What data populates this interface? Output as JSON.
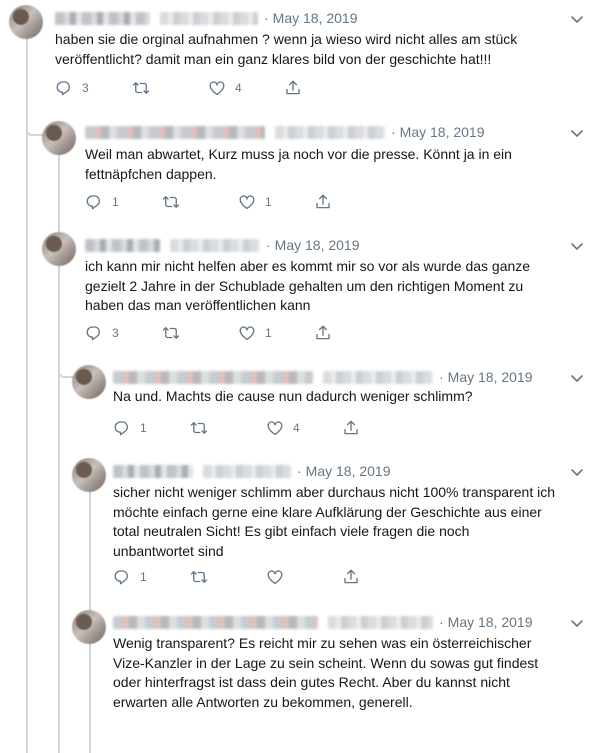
{
  "tweets": [
    {
      "date": "May 18, 2019",
      "text_lines": [
        "haben sie die orginal aufnahmen ? wenn ja wieso wird nicht alles am stück",
        "veröffentlicht? damit man ein ganz klares bild von der geschichte hat!!!"
      ],
      "replies": "3",
      "retweets": "",
      "likes": "4"
    },
    {
      "date": "May 18, 2019",
      "text_lines": [
        "Weil man abwartet, Kurz muss ja noch vor die presse. Könnt ja in ein",
        "fettnäpfchen dappen."
      ],
      "replies": "1",
      "retweets": "",
      "likes": "1"
    },
    {
      "date": "May 18, 2019",
      "text_lines": [
        "ich kann mir nicht helfen aber es kommt mir so vor als wurde das ganze",
        "gezielt 2 Jahre in der Schublade gehalten um den richtigen Moment zu",
        "haben das man veröffentlichen kann"
      ],
      "replies": "3",
      "retweets": "",
      "likes": "1"
    },
    {
      "date": "May 18, 2019",
      "text_lines": [
        "Na und. Machts die cause nun dadurch weniger schlimm?"
      ],
      "replies": "1",
      "retweets": "",
      "likes": "4"
    },
    {
      "date": "May 18, 2019",
      "text_lines": [
        "sicher nicht weniger schlimm aber durchaus nicht 100% transparent ich",
        "möchte einfach gerne eine klare Aufklärung der Geschichte aus einer",
        "total neutralen Sicht! Es gibt einfach viele fragen die noch",
        "unbantwortet sind"
      ],
      "replies": "1",
      "retweets": "",
      "likes": ""
    },
    {
      "date": "May 18, 2019",
      "text_lines": [
        "Wenig transparent? Es reicht mir zu sehen was ein österreichischer",
        "Vize-Kanzler in der Lage zu sein scheint. Wenn du sowas gut findest",
        "oder hinterfragst ist dass dein gutes Recht. Aber du kannst nicht",
        "erwarten alle Antworten zu bekommen, generell."
      ]
    }
  ],
  "colors": {
    "text": "#14171a",
    "muted": "#657786",
    "line": "#ccd6dd"
  },
  "icons": [
    "reply-icon",
    "retweet-icon",
    "like-icon",
    "share-icon",
    "chevron-down-icon"
  ]
}
